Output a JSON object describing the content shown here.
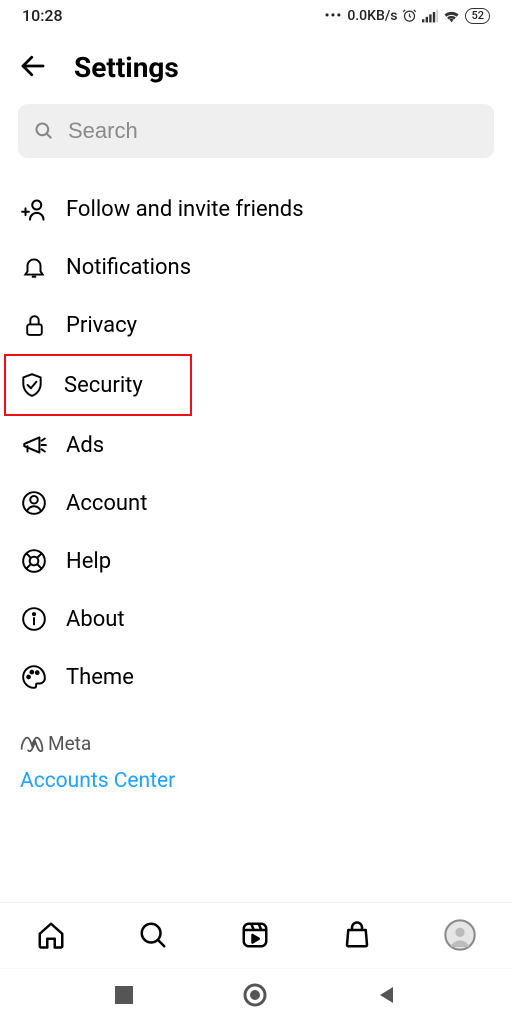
{
  "status": {
    "time": "10:28",
    "speed": "0.0KB/s",
    "battery": "52"
  },
  "header": {
    "title": "Settings"
  },
  "search": {
    "placeholder": "Search"
  },
  "menu": {
    "items": [
      {
        "label": "Follow and invite friends"
      },
      {
        "label": "Notifications"
      },
      {
        "label": "Privacy"
      },
      {
        "label": "Security"
      },
      {
        "label": "Ads"
      },
      {
        "label": "Account"
      },
      {
        "label": "Help"
      },
      {
        "label": "About"
      },
      {
        "label": "Theme"
      }
    ]
  },
  "meta": {
    "brand": "Meta",
    "accounts_center": "Accounts Center"
  }
}
